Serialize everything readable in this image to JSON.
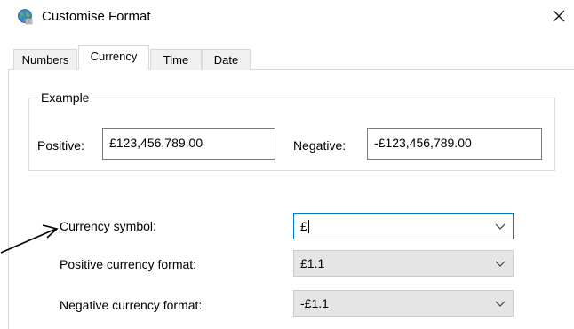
{
  "window": {
    "title": "Customise Format",
    "app_icon": "globe-settings-icon",
    "close_icon": "close-icon"
  },
  "tabs": [
    {
      "label": "Numbers",
      "active": false
    },
    {
      "label": "Currency",
      "active": true
    },
    {
      "label": "Time",
      "active": false
    },
    {
      "label": "Date",
      "active": false
    }
  ],
  "example": {
    "legend": "Example",
    "positive_label": "Positive:",
    "positive_value": "£123,456,789.00",
    "negative_label": "Negative:",
    "negative_value": "-£123,456,789.00"
  },
  "fields": {
    "currency_symbol": {
      "label": "Currency symbol:",
      "value": "£"
    },
    "positive_format": {
      "label": "Positive currency format:",
      "value": "£1.1"
    },
    "negative_format": {
      "label": "Negative currency format:",
      "value": "-£1.1"
    }
  },
  "colors": {
    "focus_border": "#0078d7",
    "disabled_fill": "#e5e5e5",
    "tab_border": "#d9d9d9"
  }
}
